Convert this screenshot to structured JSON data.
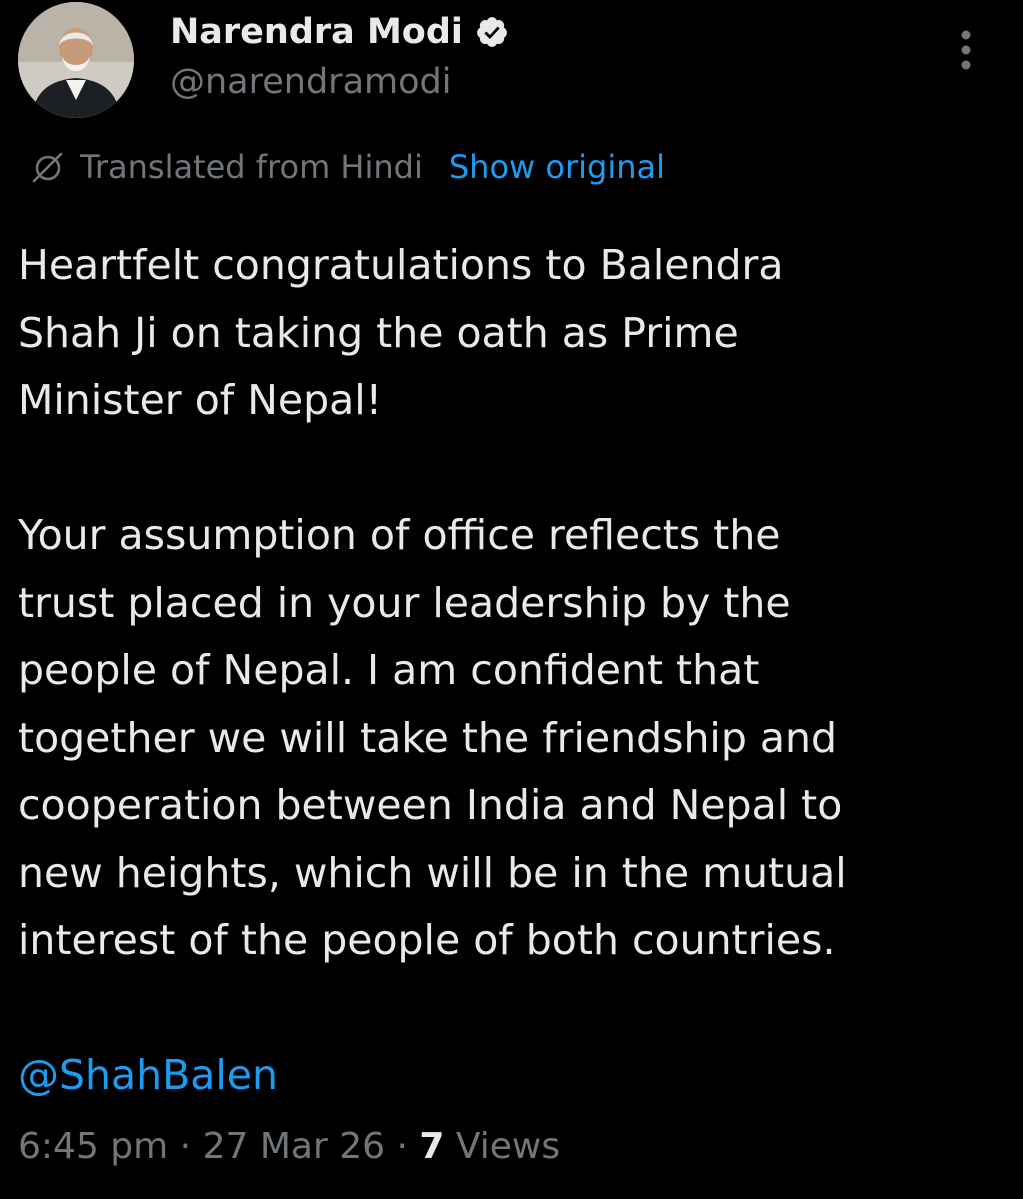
{
  "author": {
    "display_name": "Narendra Modi",
    "handle": "@narendramodi",
    "verified_icon": "verified-badge-icon",
    "badge_color": "#e7e9ea"
  },
  "translation": {
    "label": "Translated from Hindi",
    "action": "Show original",
    "icon": "globe-slash-icon"
  },
  "tweet": {
    "lines_p1": [
      "Heartfelt congratulations to Balendra",
      "Shah Ji on taking the oath as Prime",
      "Minister of Nepal!"
    ],
    "lines_p2": [
      "Your assumption of office reflects the",
      "trust placed in your leadership by the",
      "people of Nepal. I am confident that",
      "together we will take the friendship and",
      "cooperation between India and Nepal to",
      "new heights, which will be in the mutual",
      "interest of the people of both countries."
    ],
    "mention": "@ShahBalen"
  },
  "meta": {
    "time": "6:45 pm",
    "separator": "·",
    "date": "27 Mar 26",
    "views_count": "7",
    "views_label": "Views"
  },
  "colors": {
    "background": "#000000",
    "text": "#e7e9ea",
    "secondary": "#71767b",
    "link": "#1d9bf0"
  }
}
